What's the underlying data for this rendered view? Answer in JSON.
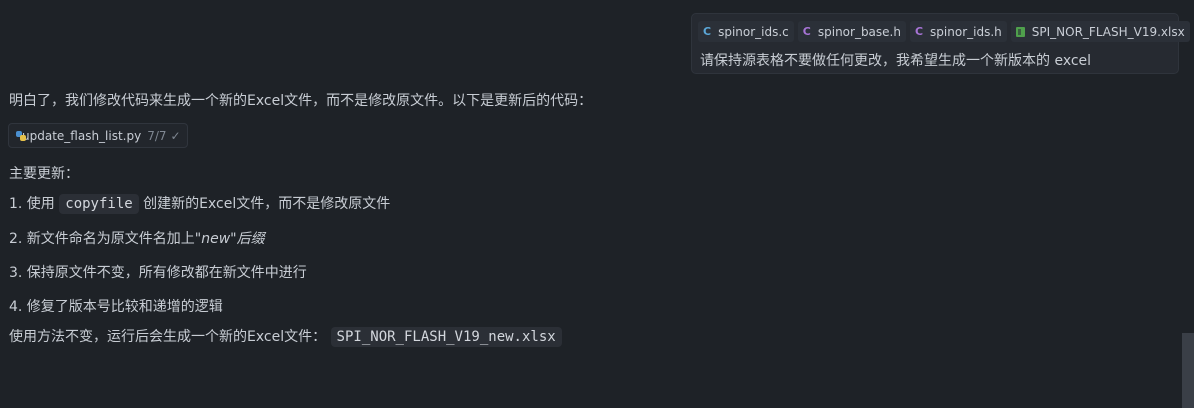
{
  "user_message": {
    "attachments": [
      {
        "icon": "c-file-icon",
        "glyph": "C",
        "name": "spinor_ids.c"
      },
      {
        "icon": "h-file-icon",
        "glyph": "C",
        "name": "spinor_base.h"
      },
      {
        "icon": "h-file-icon",
        "glyph": "C",
        "name": "spinor_ids.h"
      },
      {
        "icon": "excel-file-icon",
        "glyph": "",
        "name": "SPI_NOR_FLASH_V19.xlsx"
      }
    ],
    "text": "请保持源表格不要做任何更改，我希望生成一个新版本的 excel"
  },
  "assistant": {
    "intro": "明白了，我们修改代码来生成一个新的Excel文件，而不是修改原文件。以下是更新后的代码：",
    "file_card": {
      "name": "update_flash_list.py",
      "progress": "7/7",
      "status_glyph": "✓"
    },
    "updates_heading": "主要更新：",
    "item1": {
      "prefix": "1. 使用 ",
      "code": "copyfile",
      "suffix": " 创建新的Excel文件，而不是修改原文件"
    },
    "item2": {
      "prefix": "2. 新文件命名为原文件名加上\"",
      "italic": "new\"后缀"
    },
    "item3": "3. 保持原文件不变，所有修改都在新文件中进行",
    "item4": "4. 修复了版本号比较和递增的逻辑",
    "usage": {
      "prefix": "使用方法不变，运行后会生成一个新的Excel文件： ",
      "code": "SPI_NOR_FLASH_V19_new.xlsx"
    }
  },
  "colors": {
    "background": "#1e2227",
    "text": "#c8cdd4",
    "c_icon": "#5ba7d8",
    "h_icon": "#a774d6",
    "excel_icon": "#4fa04c"
  }
}
